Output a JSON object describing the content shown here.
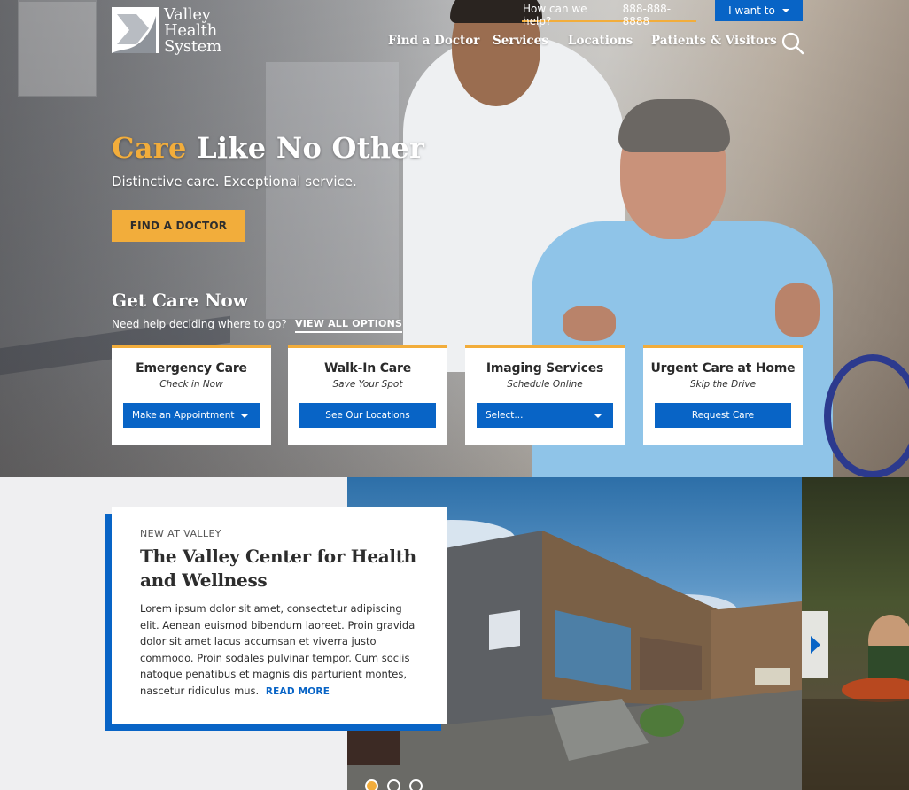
{
  "brand": {
    "name_line1": "Valley",
    "name_line2": "Health",
    "name_line3": "System"
  },
  "utility": {
    "help_label": "How can we help?",
    "phone": "888-888-8888",
    "iwant_label": "I want to"
  },
  "nav": {
    "items": [
      {
        "label": "Find a Doctor"
      },
      {
        "label": "Services"
      },
      {
        "label": "Locations"
      },
      {
        "label": "Patients & Visitors"
      }
    ]
  },
  "hero": {
    "headline_accent": "Care",
    "headline_rest": "Like No Other",
    "subhead": "Distinctive care. Exceptional service.",
    "cta_label": "FIND A DOCTOR"
  },
  "care": {
    "title": "Get Care Now",
    "help_text": "Need help deciding where to go?",
    "view_all_label": "VIEW ALL OPTIONS",
    "cards": [
      {
        "title": "Emergency Care",
        "subtitle": "Check in Now",
        "button": "Make an Appointment"
      },
      {
        "title": "Walk-In Care",
        "subtitle": "Save Your Spot",
        "button": "See Our Locations"
      },
      {
        "title": "Imaging Services",
        "subtitle": "Schedule Online",
        "button": "Select..."
      },
      {
        "title": "Urgent Care at Home",
        "subtitle": "Skip the Drive",
        "button": "Request Care"
      }
    ]
  },
  "feature": {
    "eyebrow": "NEW AT VALLEY",
    "title": "The Valley Center for Health and Wellness",
    "body": "Lorem ipsum dolor sit amet, consectetur adipiscing elit. Aenean euismod bibendum laoreet. Proin gravida dolor sit amet lacus accumsan et viverra justo commodo. Proin sodales pulvinar tempor. Cum sociis natoque penatibus et magnis dis parturient montes, nascetur ridiculus mus.",
    "read_more": "READ MORE"
  },
  "carousel": {
    "total_slides": 3,
    "active_slide": 1
  },
  "colors": {
    "accent": "#f2ad3b",
    "primary": "#0864c6"
  }
}
